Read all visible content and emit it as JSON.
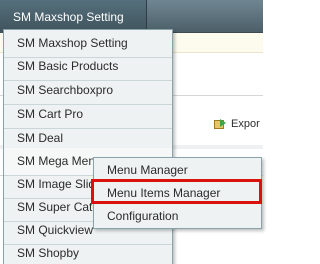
{
  "top_tab": {
    "label": "SM Maxshop Setting"
  },
  "export_button": {
    "label": "Expor"
  },
  "dropdown": {
    "items": [
      {
        "label": "SM Maxshop Setting"
      },
      {
        "label": "SM Basic Products"
      },
      {
        "label": "SM Searchboxpro"
      },
      {
        "label": "SM Cart Pro"
      },
      {
        "label": "SM Deal"
      },
      {
        "label": "SM Mega Menu"
      },
      {
        "label": "SM Image Slide"
      },
      {
        "label": "SM Super Cate"
      },
      {
        "label": "SM Quickview"
      },
      {
        "label": "SM Shopby"
      }
    ]
  },
  "submenu": {
    "items": [
      {
        "label": "Menu Manager"
      },
      {
        "label": "Menu Items Manager"
      },
      {
        "label": "Configuration"
      }
    ]
  },
  "colors": {
    "header_bg": "#55707d",
    "menu_bg": "#eef2f2",
    "highlight": "#d9120b"
  }
}
